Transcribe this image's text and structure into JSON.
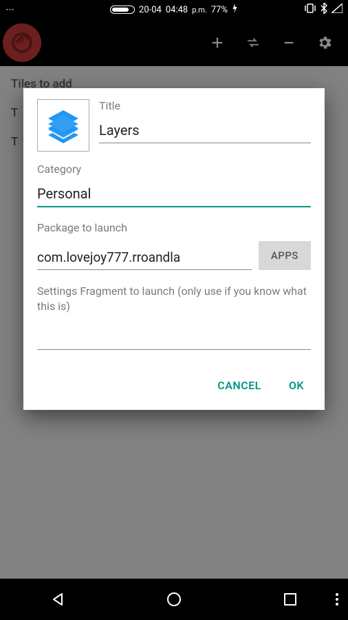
{
  "status": {
    "date": "20-04",
    "time": "04:48",
    "ampm": "p.m.",
    "battery": "77%"
  },
  "background": {
    "heading": "Tiles to add",
    "line1": "T",
    "line2": "T"
  },
  "dialog": {
    "title_label": "Title",
    "title_value": "Layers",
    "category_label": "Category",
    "category_value": "Personal",
    "package_label": "Package to launch",
    "package_value": "com.lovejoy777.rroandla",
    "apps_label": "APPS",
    "fragment_label": "Settings Fragment to launch (only use if you know what this is)",
    "fragment_value": "",
    "cancel_label": "CANCEL",
    "ok_label": "OK"
  },
  "colors": {
    "accent": "#009688",
    "tile_icon": "#2196f3"
  }
}
